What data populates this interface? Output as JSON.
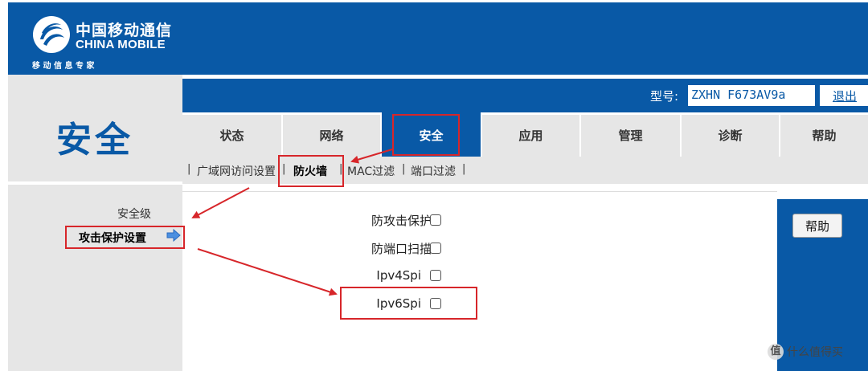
{
  "brand": {
    "name_cn": "中国移动通信",
    "name_en": "CHINA MOBILE",
    "slogan": "移 动 信 息 专 家"
  },
  "page_title": "安全",
  "model": {
    "label": "型号:",
    "value": "ZXHN F673AV9a",
    "logout": "退出"
  },
  "tabs": [
    {
      "label": "状态",
      "active": false
    },
    {
      "label": "网络",
      "active": false
    },
    {
      "label": "安全",
      "active": true
    },
    {
      "label": "应用",
      "active": false
    },
    {
      "label": "管理",
      "active": false
    },
    {
      "label": "诊断",
      "active": false
    },
    {
      "label": "帮助",
      "active": false
    }
  ],
  "subnav": {
    "separator": "|",
    "items": [
      {
        "label": "广域网访问设置",
        "active": false
      },
      {
        "label": "防火墙",
        "active": true
      },
      {
        "label": "MAC过滤",
        "active": false
      },
      {
        "label": "端口过滤",
        "active": false
      }
    ]
  },
  "left_menu": {
    "items": [
      {
        "label": "安全级",
        "active": false
      },
      {
        "label": "攻击保护设置",
        "active": true
      }
    ]
  },
  "options": [
    {
      "label": "防攻击保护",
      "checked": false
    },
    {
      "label": "防端口扫描",
      "checked": false
    },
    {
      "label": "Ipv4Spi",
      "checked": false
    },
    {
      "label": "Ipv6Spi",
      "checked": false
    }
  ],
  "help_button": "帮助",
  "watermark": {
    "icon": "值",
    "text": "什么值得买"
  },
  "colors": {
    "brand_blue": "#0959a6",
    "panel_gray": "#e6e6e6",
    "annotation_red": "#d7262a"
  }
}
